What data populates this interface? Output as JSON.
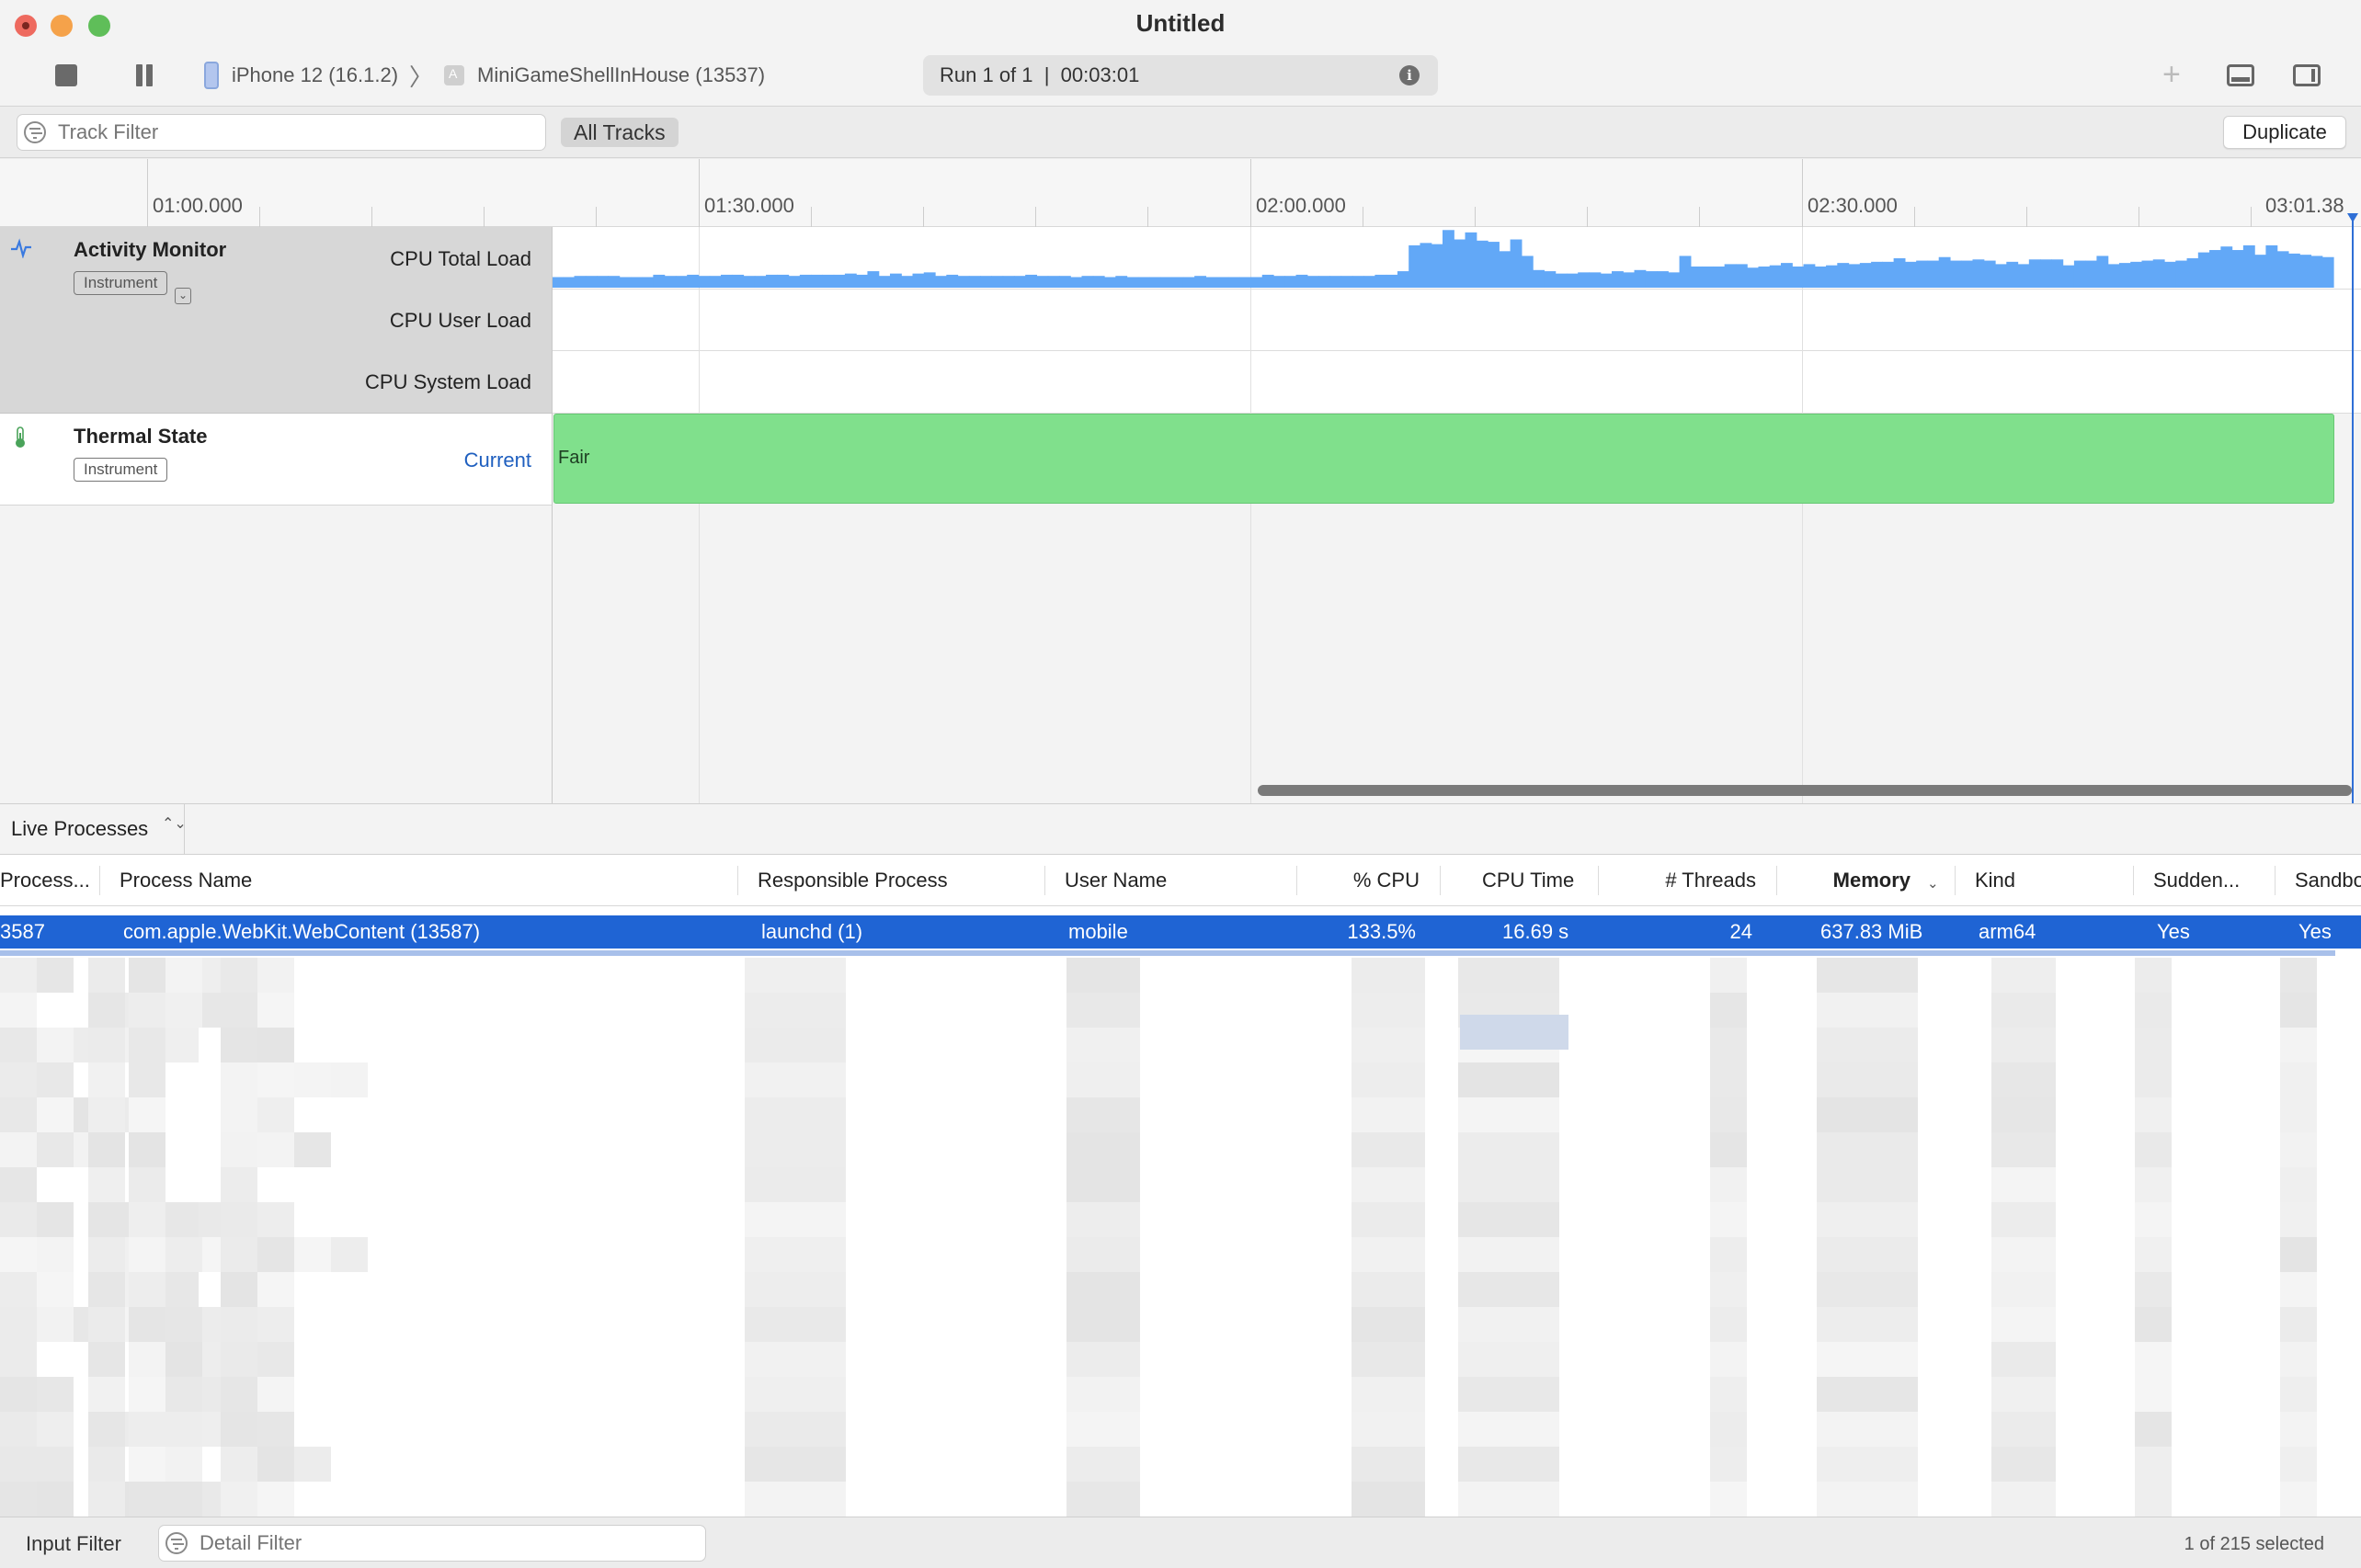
{
  "window": {
    "title": "Untitled"
  },
  "toolbar": {
    "device": "iPhone 12 (16.1.2)",
    "separator": "〉",
    "target": "MiniGameShellInHouse (13537)",
    "run_status": "Run 1 of 1  |  00:03:01",
    "info_glyph": "i",
    "plus_glyph": "+"
  },
  "filterbar": {
    "track_filter_placeholder": "Track Filter",
    "all_tracks": "All Tracks",
    "duplicate": "Duplicate"
  },
  "ruler": {
    "ticks": [
      "01:00.000",
      "01:30.000",
      "02:00.000",
      "02:30.000",
      "03:01.38"
    ]
  },
  "tracks": {
    "activity_monitor": {
      "name": "Activity Monitor",
      "badge": "Instrument",
      "chevron": "⌄",
      "lanes": [
        "CPU Total Load",
        "CPU User Load",
        "CPU System Load"
      ]
    },
    "thermal_state": {
      "name": "Thermal State",
      "badge": "Instrument",
      "lane": "Current",
      "value": "Fair"
    }
  },
  "chart_data": {
    "type": "area",
    "series": [
      {
        "values": [
          0.18,
          0.18,
          0.2,
          0.2,
          0.2,
          0.2,
          0.18,
          0.18,
          0.18,
          0.22,
          0.2,
          0.2,
          0.22,
          0.2,
          0.2,
          0.22,
          0.22,
          0.2,
          0.2,
          0.22,
          0.22,
          0.2,
          0.22,
          0.22,
          0.22,
          0.22,
          0.24,
          0.22,
          0.28,
          0.2,
          0.24,
          0.2,
          0.24,
          0.26,
          0.2,
          0.22,
          0.2,
          0.2,
          0.2,
          0.2,
          0.2,
          0.2,
          0.22,
          0.2,
          0.2,
          0.2,
          0.18,
          0.2,
          0.2,
          0.18,
          0.2,
          0.18,
          0.18,
          0.18,
          0.18,
          0.18,
          0.18,
          0.2,
          0.18,
          0.18,
          0.18,
          0.18,
          0.18,
          0.22,
          0.2,
          0.2,
          0.22,
          0.2,
          0.2,
          0.2,
          0.2,
          0.2,
          0.2,
          0.22,
          0.22,
          0.28,
          0.72,
          0.76,
          0.74,
          0.98,
          0.82,
          0.94,
          0.8,
          0.78,
          0.62,
          0.82,
          0.54,
          0.3,
          0.28,
          0.24,
          0.24,
          0.26,
          0.26,
          0.24,
          0.28,
          0.26,
          0.3,
          0.28,
          0.28,
          0.26,
          0.54,
          0.36,
          0.36,
          0.36,
          0.4,
          0.4,
          0.34,
          0.36,
          0.38,
          0.42,
          0.36,
          0.4,
          0.36,
          0.38,
          0.42,
          0.4,
          0.42,
          0.44,
          0.44,
          0.5,
          0.44,
          0.46,
          0.46,
          0.52,
          0.46,
          0.46,
          0.48,
          0.46,
          0.4,
          0.44,
          0.4,
          0.48,
          0.48,
          0.48,
          0.38,
          0.46,
          0.46,
          0.54,
          0.4,
          0.42,
          0.44,
          0.46,
          0.48,
          0.44,
          0.46,
          0.5,
          0.6,
          0.64,
          0.7,
          0.64,
          0.72,
          0.56,
          0.72,
          0.62,
          0.58,
          0.56,
          0.54,
          0.52
        ]
      }
    ],
    "ylim": [
      0,
      1
    ],
    "grid": false
  },
  "detail": {
    "view_selector": "Live Processes",
    "view_selector_glyph": "⌃⌄",
    "columns": [
      "Process...",
      "Process Name",
      "Responsible Process",
      "User Name",
      "% CPU",
      "CPU Time",
      "# Threads",
      "Memory",
      "Kind",
      "Sudden...",
      "Sandbo"
    ],
    "sort_glyph": "⌄",
    "selected_row": [
      "3587",
      "com.apple.WebKit.WebContent (13587)",
      "launchd (1)",
      "mobile",
      "133.5%",
      "16.69 s",
      "24",
      "637.83 MiB",
      "arm64",
      "Yes",
      "Yes"
    ]
  },
  "footer": {
    "input_filter": "Input Filter",
    "detail_filter_placeholder": "Detail Filter",
    "selection_count": "1 of 215 selected"
  }
}
